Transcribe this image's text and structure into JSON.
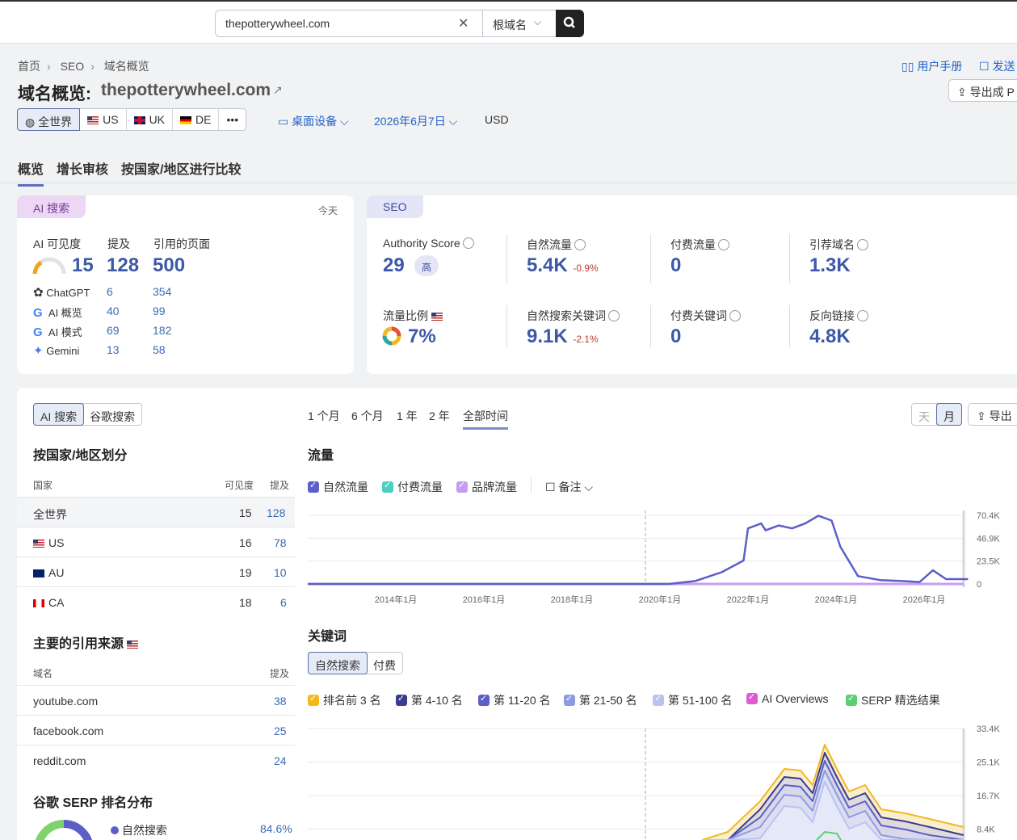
{
  "search": {
    "value": "thepotterywheel.com",
    "scope": "根域名"
  },
  "breadcrumb": [
    "首页",
    "SEO",
    "域名概览"
  ],
  "header": {
    "title": "域名概览:",
    "domain": "thepotterywheel.com",
    "help": "用户手册",
    "send": "发送",
    "export": "导出成 P"
  },
  "regions": [
    "全世界",
    "US",
    "UK",
    "DE"
  ],
  "filters": {
    "device": "桌面设备",
    "date": "2026年6月7日",
    "currency": "USD"
  },
  "tabs": [
    "概览",
    "增长审核",
    "按国家/地区进行比较"
  ],
  "ai_card": {
    "tag": "AI 搜索",
    "today": "今天",
    "headers": [
      "AI 可见度",
      "提及",
      "引用的页面"
    ],
    "visibility": "15",
    "mentions": "128",
    "cited": "500",
    "rows": [
      {
        "name": "ChatGPT",
        "mentions": "6",
        "cited": "354"
      },
      {
        "name": "AI 概览",
        "mentions": "40",
        "cited": "99"
      },
      {
        "name": "AI 模式",
        "mentions": "69",
        "cited": "182"
      },
      {
        "name": "Gemini",
        "mentions": "13",
        "cited": "58"
      }
    ]
  },
  "seo_card": {
    "tag": "SEO",
    "authority_label": "Authority Score",
    "authority_value": "29",
    "authority_badge": "高",
    "organic_label": "自然流量",
    "organic_value": "5.4K",
    "organic_change": "-0.9%",
    "paid_label": "付费流量",
    "paid_value": "0",
    "ref_domains_label": "引荐域名",
    "ref_domains_value": "1.3K",
    "share_label": "流量比例",
    "share_value": "7%",
    "organic_kw_label": "自然搜索关键词",
    "organic_kw_value": "9.1K",
    "organic_kw_change": "-2.1%",
    "paid_kw_label": "付费关键词",
    "paid_kw_value": "0",
    "backlinks_label": "反向链接",
    "backlinks_value": "4.8K"
  },
  "left_panel": {
    "toggle": [
      "AI 搜索",
      "谷歌搜索"
    ],
    "by_country_title": "按国家/地区划分",
    "by_country_headers": [
      "国家",
      "可见度",
      "提及"
    ],
    "countries": [
      {
        "name": "全世界",
        "visibility": "15",
        "mentions": "128"
      },
      {
        "name": "US",
        "visibility": "16",
        "mentions": "78"
      },
      {
        "name": "AU",
        "visibility": "19",
        "mentions": "10"
      },
      {
        "name": "CA",
        "visibility": "18",
        "mentions": "6"
      }
    ],
    "sources_title": "主要的引用来源",
    "sources_headers": [
      "域名",
      "提及"
    ],
    "sources": [
      {
        "domain": "youtube.com",
        "mentions": "38"
      },
      {
        "domain": "facebook.com",
        "mentions": "25"
      },
      {
        "domain": "reddit.com",
        "mentions": "24"
      }
    ],
    "serp_title": "谷歌 SERP 排名分布",
    "serp_item": "自然搜索",
    "serp_value": "84.6%"
  },
  "time_ranges": [
    "1 个月",
    "6 个月",
    "1 年",
    "2 年",
    "全部时间"
  ],
  "granularity": [
    "天",
    "月"
  ],
  "export_label": "导出",
  "traffic": {
    "title": "流量",
    "legend": [
      "自然流量",
      "付费流量",
      "品牌流量"
    ],
    "notes": "备注"
  },
  "keywords": {
    "title": "关键词",
    "toggle": [
      "自然搜索",
      "付费"
    ],
    "legend": [
      "排名前 3 名",
      "第 4-10 名",
      "第 11-20 名",
      "第 21-50 名",
      "第 51-100 名",
      "AI Overviews",
      "SERP 精选结果"
    ]
  },
  "chart_data": [
    {
      "type": "line",
      "title": "流量",
      "y_ticks": [
        "70.4K",
        "46.9K",
        "23.5K",
        "0"
      ],
      "x_ticks": [
        "2014年1月",
        "2016年1月",
        "2018年1月",
        "2020年1月",
        "2022年1月",
        "2024年1月",
        "2026年1月"
      ],
      "ylim": [
        0,
        70400
      ],
      "series": [
        {
          "name": "自然流量",
          "color": "#5b5fc7",
          "x": [
            2012.0,
            2020.2,
            2020.8,
            2021.4,
            2021.9,
            2022.0,
            2022.3,
            2022.4,
            2022.7,
            2023.0,
            2023.3,
            2023.6,
            2023.9,
            2024.1,
            2024.5,
            2025.0,
            2025.5,
            2025.9,
            2026.2,
            2026.5,
            2027.0
          ],
          "y": [
            0,
            0,
            3000,
            12000,
            24000,
            57000,
            62000,
            55000,
            60000,
            57000,
            62000,
            70000,
            65000,
            38000,
            8000,
            4000,
            3000,
            2000,
            14000,
            5000,
            5000
          ]
        }
      ]
    },
    {
      "type": "area",
      "title": "关键词",
      "y_ticks": [
        "33.4K",
        "25.1K",
        "16.7K",
        "8.4K"
      ],
      "ylim": [
        0,
        33400
      ],
      "series": [
        {
          "name": "排名前 3 名",
          "color": "#f2b81e"
        },
        {
          "name": "第 4-10 名",
          "color": "#3b3c8c"
        },
        {
          "name": "第 11-20 名",
          "color": "#5b5fc7"
        },
        {
          "name": "第 21-50 名",
          "color": "#8f9be0"
        },
        {
          "name": "第 51-100 名",
          "color": "#b9c3f0"
        }
      ]
    }
  ],
  "colors": {
    "accent": "#3c58a8",
    "link": "#2362c7",
    "ai_tag_bg": "#ecd8f4",
    "seo_tag_bg": "#e4e6f7"
  }
}
